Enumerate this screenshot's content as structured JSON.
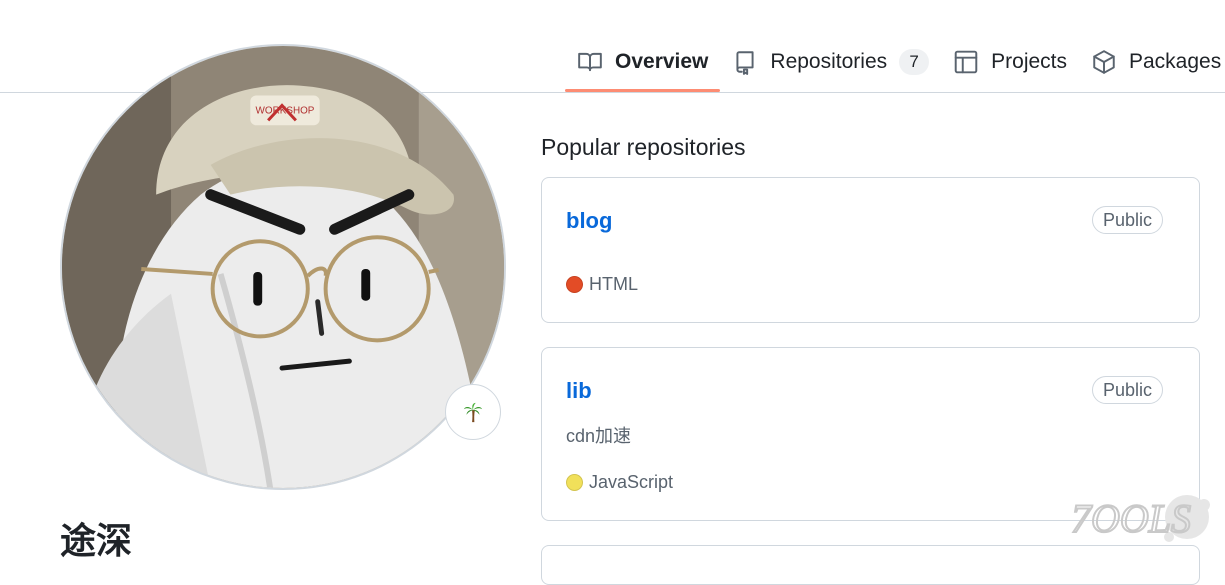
{
  "tabs": [
    {
      "label": "Overview",
      "icon": "book-icon",
      "active": true
    },
    {
      "label": "Repositories",
      "icon": "repo-icon",
      "count": "7"
    },
    {
      "label": "Projects",
      "icon": "table-icon"
    },
    {
      "label": "Packages",
      "icon": "package-icon"
    }
  ],
  "profile": {
    "name": "途深",
    "status_icon": "palm-tree-icon"
  },
  "popular": {
    "title": "Popular repositories",
    "repos": [
      {
        "name": "blog",
        "visibility": "Public",
        "description": "",
        "language": "HTML",
        "language_color": "#e34c26"
      },
      {
        "name": "lib",
        "visibility": "Public",
        "description": "cdn加速",
        "language": "JavaScript",
        "language_color": "#f1e05a"
      }
    ]
  },
  "watermark": {
    "text": "7OOLS"
  }
}
